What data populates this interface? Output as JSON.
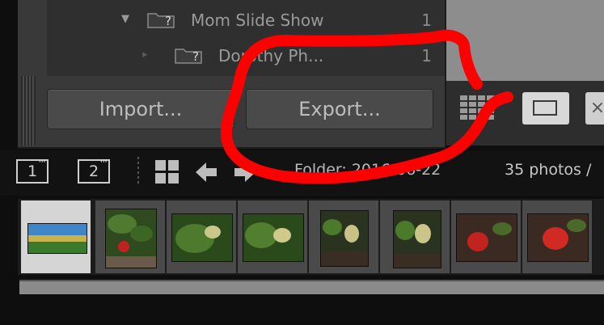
{
  "folders": [
    {
      "name": "Mom Slide Show",
      "count": "1"
    },
    {
      "name": "Dorothy Ph...",
      "count": "1"
    }
  ],
  "folder_badge": "?",
  "buttons": {
    "import": "Import...",
    "export": "Export..."
  },
  "compare_glyph": "×",
  "film_header": {
    "screen1": "1",
    "screen2": "2",
    "breadcrumb": "Folder: 2016-06-22",
    "photo_count": "35 photos /"
  },
  "thumbnails": [
    {
      "subject": "landscape",
      "selected": true
    },
    {
      "subject": "strawberry-plant"
    },
    {
      "subject": "green-strawberry"
    },
    {
      "subject": "green-strawberry"
    },
    {
      "subject": "green-strawberry"
    },
    {
      "subject": "green-strawberry"
    },
    {
      "subject": "red-strawberry"
    },
    {
      "subject": "red-strawberry"
    }
  ],
  "annotation_color": "#ff0000"
}
